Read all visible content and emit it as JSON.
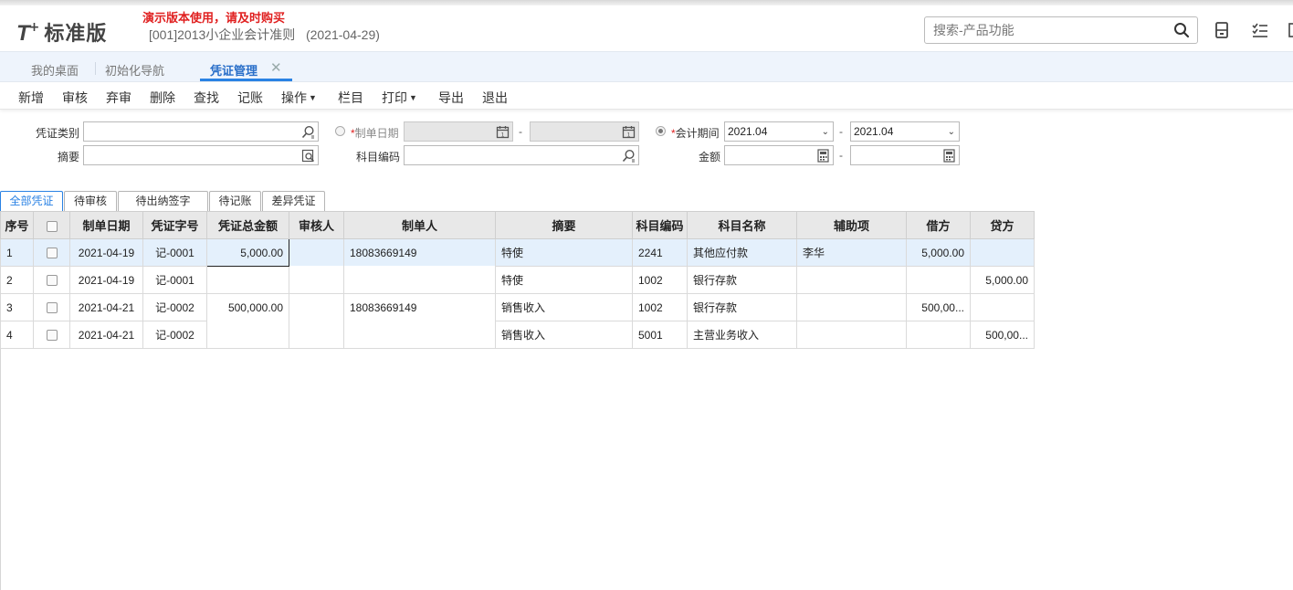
{
  "header": {
    "logo_t": "T",
    "logo_plus": "+",
    "logo_text": "标准版",
    "demo_note": "演示版本使用，请及时购买",
    "account_info": "[001]2013小企业会计准则   (2021-04-29)",
    "search_placeholder": "搜索-产品功能"
  },
  "tabs": [
    {
      "label": "我的桌面"
    },
    {
      "label": "初始化导航"
    },
    {
      "label": "凭证管理"
    }
  ],
  "toolbar": {
    "new": "新增",
    "audit": "审核",
    "unaudit": "弃审",
    "delete": "删除",
    "find": "查找",
    "post": "记账",
    "operate": "操作",
    "columns": "栏目",
    "print": "打印",
    "export": "导出",
    "exit": "退出"
  },
  "filters": {
    "voucher_type_label": "凭证类别",
    "summary_label": "摘要",
    "create_date_label": "制单日期",
    "account_code_label": "科目编码",
    "period_label": "会计期间",
    "amount_label": "金额",
    "period_from": "2021.04",
    "period_to": "2021.04",
    "required_mark": "*",
    "dash": "-"
  },
  "filter_tabs": [
    {
      "label": "全部凭证"
    },
    {
      "label": "待审核"
    },
    {
      "label": "待出纳签字"
    },
    {
      "label": "待记账"
    },
    {
      "label": "差异凭证"
    }
  ],
  "grid": {
    "headers": [
      "序号",
      "",
      "制单日期",
      "凭证字号",
      "凭证总金额",
      "审核人",
      "制单人",
      "摘要",
      "科目编码",
      "科目名称",
      "辅助项",
      "借方",
      "贷方"
    ],
    "rows": [
      {
        "no": "1",
        "date": "2021-04-19",
        "voucher": "记-0001",
        "total": "5,000.00",
        "auditor": "",
        "maker": "18083669149",
        "summary": "特使",
        "code": "2241",
        "name": "其他应付款",
        "aux": "李华",
        "debit": "5,000.00",
        "credit": ""
      },
      {
        "no": "2",
        "date": "2021-04-19",
        "voucher": "记-0001",
        "total": "",
        "auditor": "",
        "maker": "",
        "summary": "特使",
        "code": "1002",
        "name": "银行存款",
        "aux": "",
        "debit": "",
        "credit": "5,000.00"
      },
      {
        "no": "3",
        "date": "2021-04-21",
        "voucher": "记-0002",
        "total": "500,000.00",
        "auditor": "",
        "maker": "18083669149",
        "summary": "销售收入",
        "code": "1002",
        "name": "银行存款",
        "aux": "",
        "debit": "500,00...",
        "credit": ""
      },
      {
        "no": "4",
        "date": "2021-04-21",
        "voucher": "记-0002",
        "total": "",
        "auditor": "",
        "maker": "",
        "summary": "销售收入",
        "code": "5001",
        "name": "主营业务收入",
        "aux": "",
        "debit": "",
        "credit": "500,00..."
      }
    ]
  }
}
